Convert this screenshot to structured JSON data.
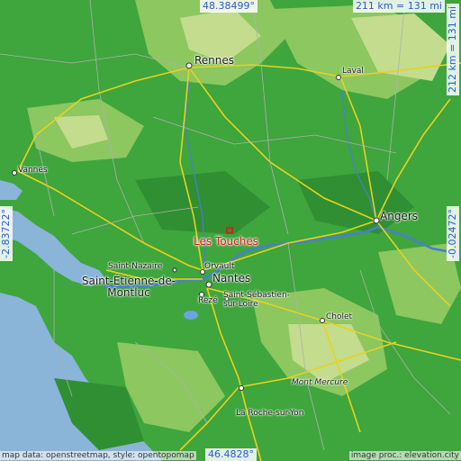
{
  "map": {
    "title": "Les Touches",
    "colors": {
      "sea": "#8ab4d8",
      "lowland": "#3fa53d",
      "midland": "#8cc760",
      "upland": "#c4dc8e",
      "roads": "#e8d21e",
      "highlight": "#e8141c",
      "coord_text": "#2a5ad8"
    },
    "coords": {
      "top_lat": "48.38499°",
      "bottom_lat": "46.4828°",
      "left_lon": "-2.83722°",
      "right_lon": "-0.02472°",
      "scale_horizontal": "211 km = 131 mi",
      "scale_vertical": "212 km = 131 mi"
    },
    "places": {
      "rennes": "Rennes",
      "laval": "Laval",
      "vannes": "Vannes",
      "angers": "Angers",
      "les_touches": "Les Touches",
      "saint_nazaire": "Saint-Nazaire",
      "saint_etienne": "Saint-Étienne-de-Montluc",
      "orvault": "Orvault",
      "nantes": "Nantes",
      "reze": "Rezé",
      "saint_sebastien": "Saint-Sébastien-sur-Loire",
      "cholet": "Cholet",
      "mont_mercure": "Mont Mercure",
      "la_roche": "La Roche-sur-Yon"
    },
    "credits": {
      "left": "map data: openstreetmap, style: opentopomap",
      "right": "image proc.: elevation.city"
    }
  }
}
